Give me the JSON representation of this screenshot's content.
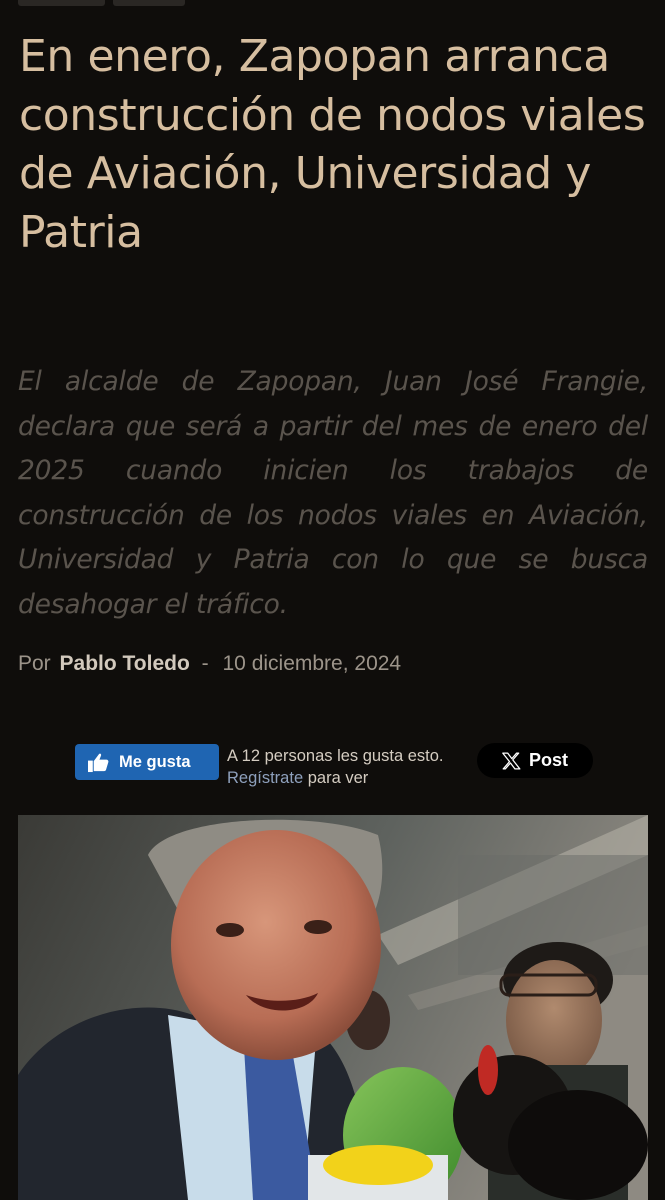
{
  "article": {
    "title": "En enero, Zapopan arranca construcción de nodos viales de Aviación, Universidad y Patria",
    "summary": "El alcalde de Zapopan, Juan José Frangie, declara que será a partir del mes de enero del 2025 cuando inicien los trabajos de construcción de los nodos viales en Aviación, Universidad y Patria con lo que se busca desahogar el tráfico.",
    "byline": {
      "prefix": "Por",
      "author": "Pablo Toledo",
      "separator": "-",
      "date": "10 diciembre, 2024"
    }
  },
  "social": {
    "like_button_label": "Me gusta",
    "like_text": "A 12 personas les gusta esto.",
    "register_link": "Regístrate",
    "register_suffix": "para ver",
    "post_button_label": "Post",
    "like_icon": "thumbs-up-icon",
    "post_icon": "x-logo-icon"
  },
  "image": {
    "description_icon": "news-photo"
  },
  "colors": {
    "background": "#0f0d0b",
    "title": "#d6bea0",
    "summary": "#5a544d",
    "author": "#d2c9bd",
    "meta": "#9c948a",
    "facebook_blue": "#1f65b2",
    "link": "#8ea0bc"
  }
}
